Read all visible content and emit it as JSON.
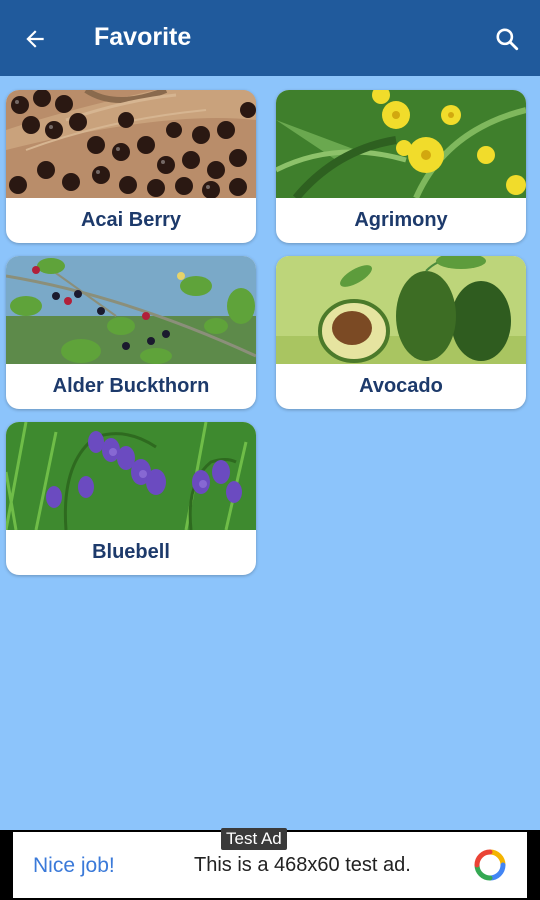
{
  "header": {
    "title": "Favorite",
    "back_icon": "arrow-left-icon",
    "search_icon": "search-icon"
  },
  "colors": {
    "appbar": "#205a9c",
    "background": "#8cc4fb",
    "card": "#ffffff",
    "label": "#1d3a6b"
  },
  "favorites": [
    {
      "name": "Acai Berry"
    },
    {
      "name": "Agrimony"
    },
    {
      "name": "Alder Buckthorn"
    },
    {
      "name": "Avocado"
    },
    {
      "name": "Bluebell"
    }
  ],
  "ad": {
    "tag": "Test Ad",
    "cta": "Nice job!",
    "text": "This is a 468x60 test ad."
  }
}
